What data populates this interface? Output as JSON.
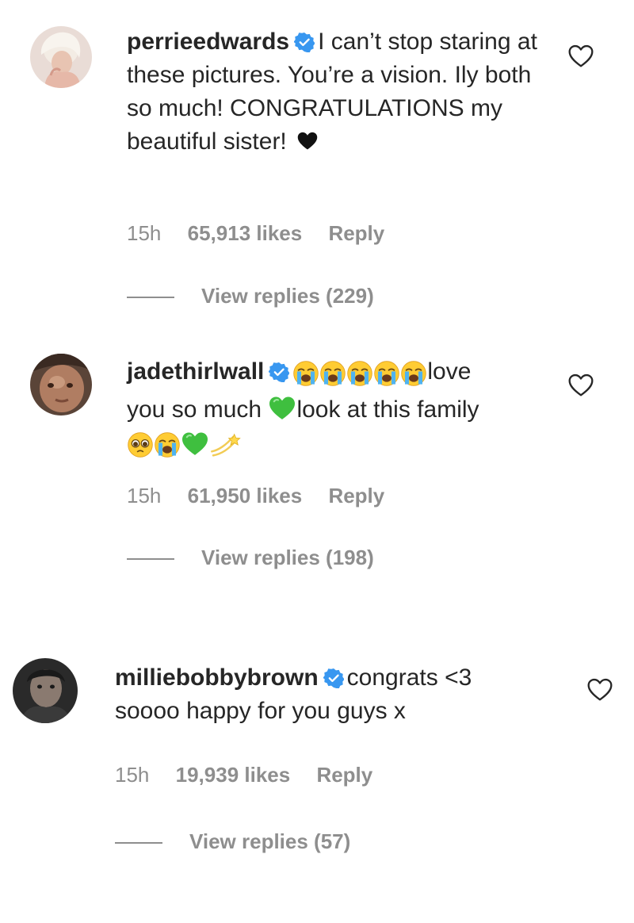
{
  "comments": [
    {
      "username": "perrieedwards",
      "verified": true,
      "text": "I can’t stop staring at these pictures. You’re a vision. Ily both so much! CONGRATULATIONS my beautiful sister!",
      "trailing_emoji": "black-heart",
      "time": "15h",
      "likes": "65,913 likes",
      "reply_label": "Reply",
      "view_replies": "View replies (229)"
    },
    {
      "username": "jadethirlwall",
      "verified": true,
      "text_part1": "love",
      "text_part2": "you so much",
      "text_part3": "look at this family",
      "emojis_line1": [
        "loudly-crying-face",
        "loudly-crying-face",
        "loudly-crying-face",
        "loudly-crying-face",
        "loudly-crying-face"
      ],
      "emoji_mid": "green-heart",
      "emojis_line3": [
        "pleading-face",
        "loudly-crying-face",
        "green-heart",
        "dizzy"
      ],
      "time": "15h",
      "likes": "61,950 likes",
      "reply_label": "Reply",
      "view_replies": "View replies (198)"
    },
    {
      "username": "milliebobbybrown",
      "verified": true,
      "text_part1": "congrats <3",
      "text_part2": "soooo happy for you guys x",
      "time": "15h",
      "likes": "19,939 likes",
      "reply_label": "Reply",
      "view_replies": "View replies (57)"
    }
  ],
  "colors": {
    "text": "#262626",
    "meta": "#8e8e8e",
    "verified": "#3897f0",
    "green_heart": "#3fbf3f"
  }
}
